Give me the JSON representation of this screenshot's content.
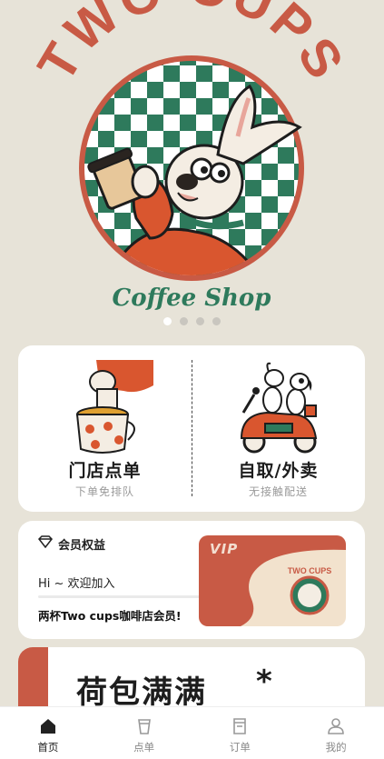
{
  "hero": {
    "brand_top": "TWO CUPS",
    "brand_bottom": "Coffee Shop",
    "carousel_total": 4,
    "carousel_active": 0
  },
  "order": {
    "dine_in": {
      "title": "门店点单",
      "subtitle": "下单免排队"
    },
    "delivery": {
      "title": "自取/外卖",
      "subtitle": "无接触配送"
    }
  },
  "member": {
    "label": "会员权益",
    "welcome": "Hi ~ 欢迎加入",
    "description": "两杯Two cups咖啡店会员!",
    "vip_label": "VIP",
    "vip_brand": "TWO CUPS"
  },
  "wallet": {
    "title": "荷包满满",
    "mark": "*"
  },
  "tabbar": {
    "items": [
      {
        "label": "首页",
        "icon": "home-icon",
        "active": true
      },
      {
        "label": "点单",
        "icon": "cup-icon",
        "active": false
      },
      {
        "label": "订单",
        "icon": "receipt-icon",
        "active": false
      },
      {
        "label": "我的",
        "icon": "user-icon",
        "active": false
      }
    ]
  },
  "colors": {
    "background": "#e7e3d8",
    "brand_red": "#c85a45",
    "checker_green": "#2e7a5c",
    "card": "#ffffff"
  }
}
